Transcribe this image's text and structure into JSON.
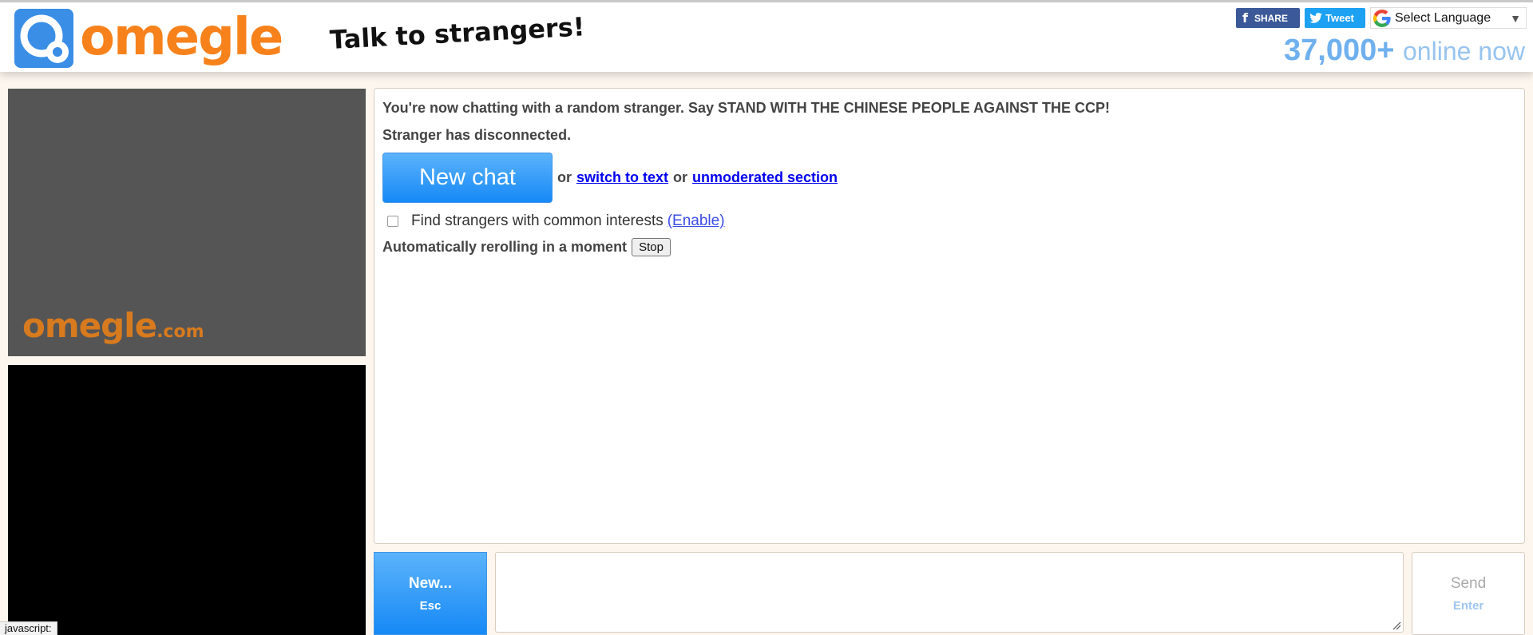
{
  "header": {
    "logo_text": "omegle",
    "tagline": "Talk to strangers!",
    "share_label": "SHARE",
    "tweet_label": "Tweet",
    "translate_label": "Select Language",
    "online_count": "37,000+",
    "online_label": "online now"
  },
  "video": {
    "watermark_main": "omegle",
    "watermark_suffix": ".com"
  },
  "chat": {
    "intro_message": "You're now chatting with a random stranger. Say STAND WITH THE CHINESE PEOPLE AGAINST THE CCP!",
    "disconnect_message": "Stranger has disconnected.",
    "new_chat_label": "New chat",
    "or_1": "or",
    "switch_text_link": "switch to text",
    "or_2": "or",
    "unmoderated_link": "unmoderated section",
    "interests_label": "Find strangers with common interests",
    "enable_link": "(Enable)",
    "reroll_text": "Automatically rerolling in a moment",
    "stop_label": "Stop"
  },
  "controls": {
    "new_label": "New...",
    "new_key": "Esc",
    "send_label": "Send",
    "send_key": "Enter",
    "message_value": ""
  },
  "status_bar": {
    "text": "javascript:"
  },
  "colors": {
    "brand_orange": "#f7821c",
    "brand_blue": "#3a8ee6",
    "button_blue": "#1689f6",
    "page_bg": "#fcf6ee"
  }
}
